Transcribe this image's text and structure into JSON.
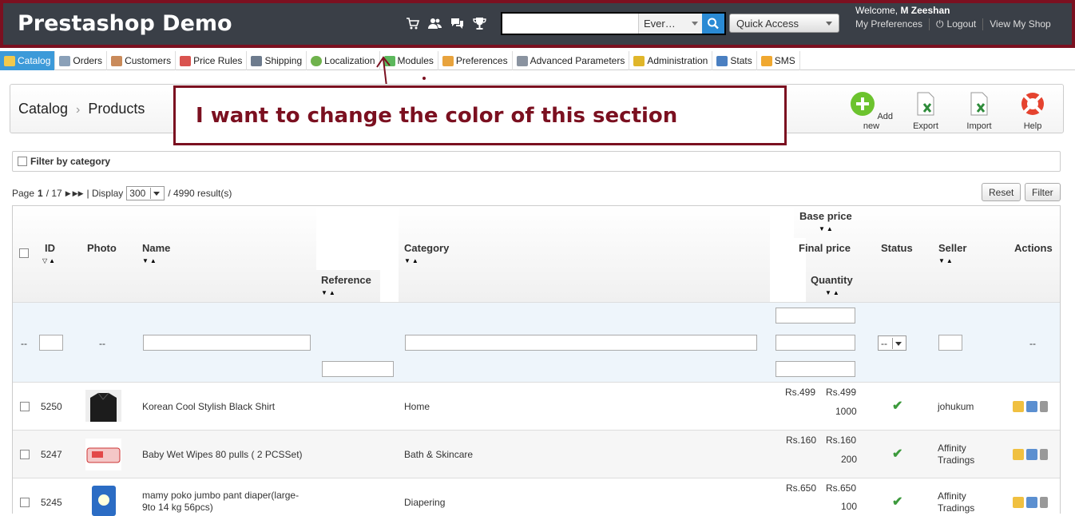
{
  "header": {
    "title": "Prestashop Demo",
    "search_scope": "Ever…",
    "quick_access": "Quick Access",
    "welcome_prefix": "Welcome, ",
    "user": "M Zeeshan",
    "links": [
      "My Preferences",
      "Logout",
      "View My Shop"
    ]
  },
  "tabs": [
    "Catalog",
    "Orders",
    "Customers",
    "Price Rules",
    "Shipping",
    "Localization",
    "Modules",
    "Preferences",
    "Advanced Parameters",
    "Administration",
    "Stats",
    "SMS"
  ],
  "breadcrumb": [
    "Catalog",
    "Products"
  ],
  "toolbar": [
    "Add new",
    "Export",
    "Import",
    "Help"
  ],
  "annotation": "I want to change the color of this section",
  "filter_by_category": "Filter by category",
  "paging": {
    "page_label": "Page",
    "page": "1",
    "of": "/ 17",
    "display_label": "| Display",
    "per_page": "300",
    "results": "/ 4990 result(s)"
  },
  "buttons": {
    "reset": "Reset",
    "filter": "Filter"
  },
  "columns": {
    "id": "ID",
    "photo": "Photo",
    "name": "Name",
    "reference": "Reference",
    "category": "Category",
    "base_price": "Base price",
    "final_price": "Final price",
    "quantity": "Quantity",
    "status": "Status",
    "seller": "Seller",
    "actions": "Actions"
  },
  "filter_row": {
    "dash": "--",
    "status_value": "--"
  },
  "rows": [
    {
      "id": "5250",
      "name": "Korean Cool Stylish Black Shirt",
      "name2": "",
      "category": "Home",
      "base": "Rs.499",
      "final": "Rs.499",
      "qty": "1000",
      "seller": "johukum",
      "seller2": ""
    },
    {
      "id": "5247",
      "name": "Baby Wet Wipes 80 pulls ( 2 PCSSet)",
      "name2": "",
      "category": "Bath & Skincare",
      "base": "Rs.160",
      "final": "Rs.160",
      "qty": "200",
      "seller": "Affinity",
      "seller2": "Tradings"
    },
    {
      "id": "5245",
      "name": "mamy poko jumbo pant diaper(large-",
      "name2": "9to 14 kg 56pcs)",
      "category": "Diapering",
      "base": "Rs.650",
      "final": "Rs.650",
      "qty": "100",
      "seller": "Affinity",
      "seller2": "Tradings"
    }
  ],
  "colors": {
    "header_bg": "#3a3f47",
    "annotation": "#7b1020",
    "active_tab": "#3c9ad9",
    "filter_row_bg": "#eef5fb"
  }
}
